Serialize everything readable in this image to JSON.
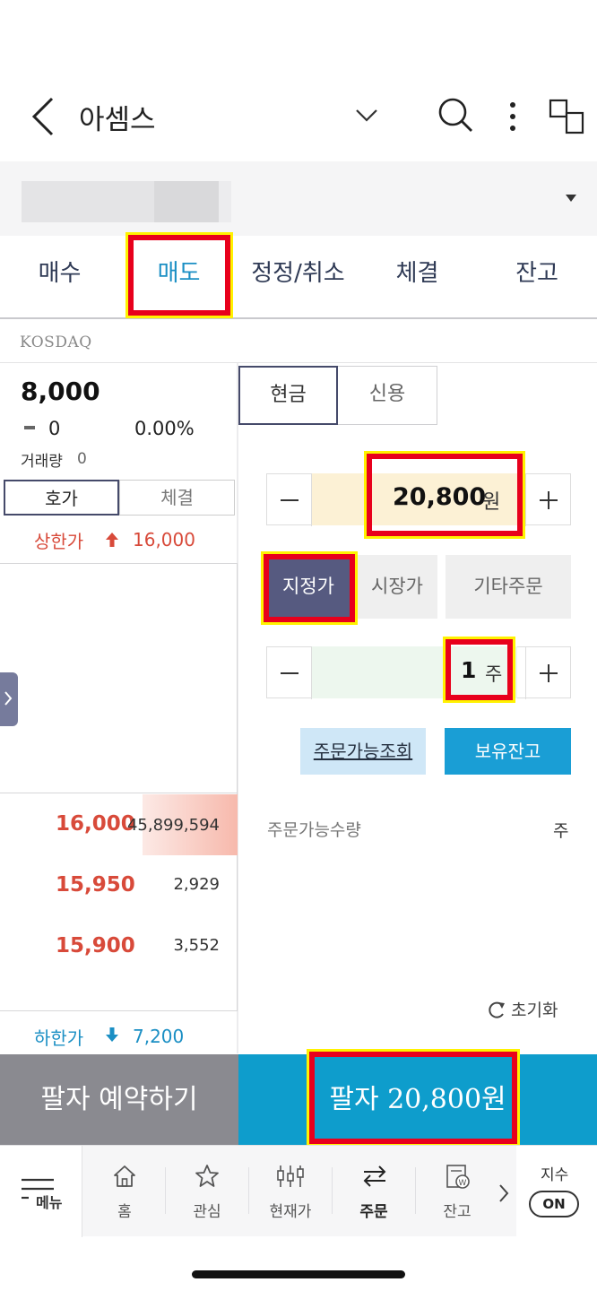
{
  "header": {
    "title": "아셈스"
  },
  "tabs": [
    {
      "label": "매수"
    },
    {
      "label": "매도"
    },
    {
      "label": "정정/취소"
    },
    {
      "label": "체결"
    },
    {
      "label": "잔고"
    }
  ],
  "market": "KOSDAQ",
  "quote": {
    "price": "8,000",
    "change": "0",
    "change_pct": "0.00%",
    "volume_label": "거래량",
    "volume": "0"
  },
  "left_tabs": [
    "호가",
    "체결"
  ],
  "limits": {
    "up_label": "상한가",
    "up_value": "16,000",
    "down_label": "하한가",
    "down_value": "7,200"
  },
  "orderbook": [
    {
      "price": "16,000",
      "qty": "45,899,594"
    },
    {
      "price": "15,950",
      "qty": "2,929"
    },
    {
      "price": "15,900",
      "qty": "3,552"
    }
  ],
  "account_types": [
    "현금",
    "신용"
  ],
  "order": {
    "price_value": "20,800",
    "price_unit": "원",
    "order_types": [
      "지정가",
      "시장가",
      "기타주문"
    ],
    "qty_value": "1",
    "qty_unit": "주",
    "inquiry_label": "주문가능조회",
    "holdings_label": "보유잔고",
    "available_label": "주문가능수량",
    "available_unit": "주",
    "reset_label": "초기화"
  },
  "actions": {
    "reserve_label": "팔자 예약하기",
    "sell_label": "팔자 20,800원"
  },
  "bottom_nav": [
    {
      "label": "메뉴",
      "icon": "menu-icon"
    },
    {
      "label": "홈",
      "icon": "home-icon"
    },
    {
      "label": "관심",
      "icon": "star-icon"
    },
    {
      "label": "현재가",
      "icon": "candlestick-icon"
    },
    {
      "label": "주문",
      "icon": "swap-icon"
    },
    {
      "label": "잔고",
      "icon": "balance-icon"
    },
    {
      "label": "지수",
      "icon": "index-toggle"
    }
  ],
  "index_toggle": "ON",
  "colors": {
    "accent_blue": "#1a9ed5",
    "up_red": "#d84a3a",
    "selected_order_type": "#565a80",
    "highlight_border": "#e8001c",
    "highlight_outline": "#fff200"
  }
}
